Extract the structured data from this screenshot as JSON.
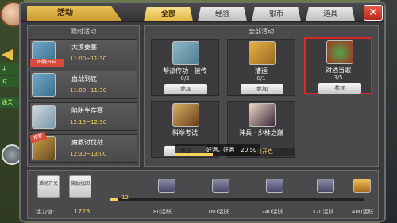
{
  "window": {
    "title": "活动"
  },
  "side": {
    "tags": [
      "主",
      "时",
      "通关"
    ]
  },
  "tabs": [
    {
      "label": "全部",
      "active": true
    },
    {
      "label": "经验",
      "active": false
    },
    {
      "label": "银币",
      "active": false
    },
    {
      "label": "道具",
      "active": false
    }
  ],
  "limited": {
    "header": "限时活动",
    "items": [
      {
        "name": "大漠要塞",
        "time": "11:00~11:30",
        "badge": "图腾开启"
      },
      {
        "name": "血战到底",
        "time": "11:00~11:30",
        "badge": ""
      },
      {
        "name": "陷阱生存赛",
        "time": "12:15~12:30",
        "badge": ""
      },
      {
        "name": "魔教讨伐战",
        "time": "12:30~13:00",
        "badge": "推荐"
      }
    ]
  },
  "all": {
    "header": "全部活动",
    "cards": [
      {
        "name": "帮派传功 · 被传",
        "progress": "0/2",
        "button": "参加",
        "icon": "scroll-icon"
      },
      {
        "name": "漕运",
        "progress": "0/1",
        "button": "参加",
        "icon": "cargo-icon"
      },
      {
        "name": "对酒当歌",
        "progress": "3/5",
        "button": "参加",
        "icon": "wine-icon",
        "selected": true
      },
      {
        "name": "科举考试",
        "progress": "",
        "button": "参加",
        "icon": "exam-icon"
      },
      {
        "name": "神兵 · 少林之巅",
        "progress": "",
        "open": "75级开启",
        "icon": "hero-icon"
      }
    ],
    "bubble": {
      "text": "好酒，好酒",
      "time": "20:50"
    }
  },
  "bottom": {
    "btn_push": "活动开关",
    "btn_reward": "奖励找回",
    "vitality_label": "活力值:",
    "vitality_value": "1728",
    "current_mark": "12",
    "milestones": [
      "80活跃",
      "160活跃",
      "240活跃",
      "320活跃",
      "400活跃"
    ],
    "progress_ratio": 0.03
  },
  "colors": {
    "accent": "#e0b640",
    "selected_border": "#d8262a"
  }
}
